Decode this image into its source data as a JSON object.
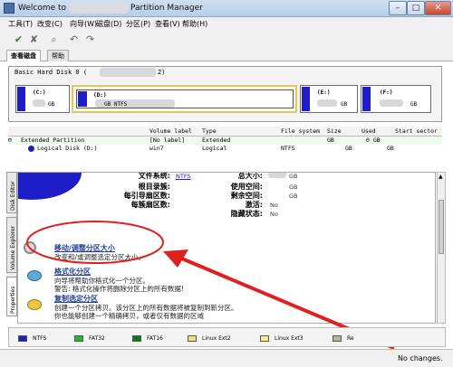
{
  "window": {
    "title_prefix": "Welcome to",
    "title_suffix": "Partition Manager",
    "minimize": "–",
    "maximize": "□",
    "close": "✕"
  },
  "menu": [
    "工具(T)",
    "改变(C)",
    "向导(W)",
    "磁盘(D)",
    "分区(P)",
    "查看(V)",
    "帮助(H)"
  ],
  "toolbar": {
    "apply": "✔",
    "discard": "✘",
    "search": "⌕",
    "undo": "↶",
    "redo": "↷"
  },
  "tabs": [
    "查看磁盘",
    "帮助"
  ],
  "disk": {
    "label": "Basic Hard Disk 0 (",
    "label_end": "2)",
    "partitions": [
      {
        "letter": "(C:)",
        "size": "GB",
        "fs": ""
      },
      {
        "letter": "(D:)",
        "size": "GB NTFS",
        "fs": "NTFS"
      },
      {
        "letter": "(E:)",
        "size": "GB",
        "fs": ""
      },
      {
        "letter": "(F:)",
        "size": "GB",
        "fs": ""
      }
    ]
  },
  "list": {
    "columns": [
      "Volume label",
      "Type",
      "File system",
      "Size",
      "Used",
      "Start sector"
    ],
    "rows": [
      {
        "name": "Extended Partition",
        "label": "[No label]",
        "type": "Extended",
        "fs": "",
        "size": "GB",
        "used": "0 GB"
      },
      {
        "name": "Logical Disk (D:)",
        "label": "win7",
        "type": "Logical",
        "fs": "NTFS",
        "size": "GB",
        "used": "GB"
      }
    ]
  },
  "sidebar_tabs": [
    "Disk Editor",
    "Volume Explorer",
    "Properties"
  ],
  "properties": {
    "left": [
      {
        "label": "文件系统:",
        "value": "NTFS"
      },
      {
        "label": "根目录簇:",
        "value": ""
      },
      {
        "label": "每引导扇区数:",
        "value": ""
      },
      {
        "label": "每簇扇区数:",
        "value": ""
      }
    ],
    "right": [
      {
        "label": "总大小:",
        "value": "GB"
      },
      {
        "label": "使用空间:",
        "value": "GB"
      },
      {
        "label": "剩余空间:",
        "value": "GB"
      },
      {
        "label": "激活:",
        "value": "No"
      },
      {
        "label": "隐藏状态:",
        "value": "No"
      }
    ]
  },
  "actions": [
    {
      "title": "移动/调整分区大小",
      "desc1": "改变和/或调整选定分区大小。",
      "desc2": ""
    },
    {
      "title": "格式化分区",
      "desc1": "向导将帮助你格式化一个分区。",
      "desc2": "警告: 格式化操作将删除分区上的所有数据!"
    },
    {
      "title": "复制选定分区",
      "desc1": "创建一个分区拷贝。该分区上的所有数据将被复制到新分区。",
      "desc2": "你也能够创建一个精确拷贝，或者仅有数据的区域"
    }
  ],
  "legend": [
    {
      "name": "NTFS",
      "color": "#1d1ec8"
    },
    {
      "name": "FAT32",
      "color": "#22b833"
    },
    {
      "name": "FAT16",
      "color": "#0a7a12"
    },
    {
      "name": "Linux Ext2",
      "color": "#e7e27a"
    },
    {
      "name": "Linux Ext3",
      "color": "#f2ef95"
    },
    {
      "name": "Re",
      "color": "#b9b4a0"
    }
  ],
  "status": {
    "text": "No changes."
  }
}
